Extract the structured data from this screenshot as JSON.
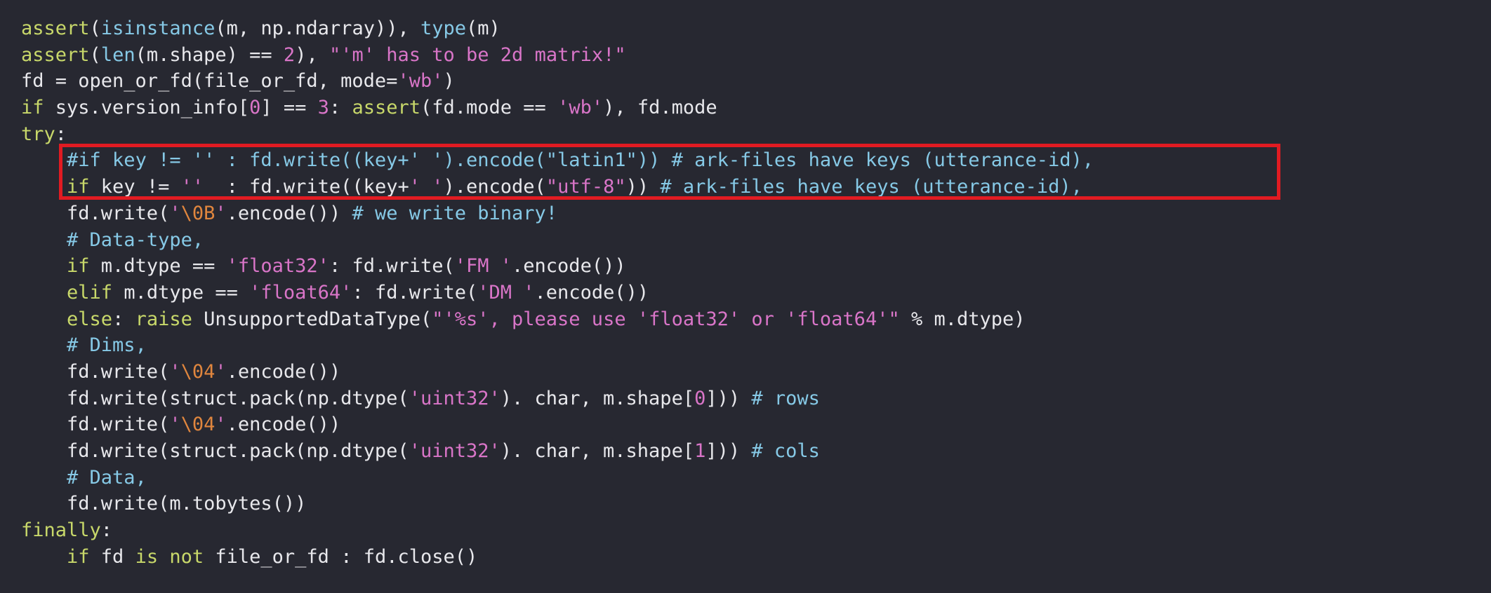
{
  "editor": {
    "colors": {
      "background": "#272831",
      "default": "#e8e8ec",
      "keyword": "#c8d86a",
      "builtin": "#86c9e6",
      "string": "#d975c8",
      "number": "#d975c8",
      "comment": "#86c9e6",
      "escape": "#e0863e",
      "highlight_border": "#e11b22"
    },
    "highlighted_lines": [
      5,
      6
    ],
    "lines": [
      [
        [
          "kw",
          "assert"
        ],
        [
          "def",
          "("
        ],
        [
          "fn",
          "isinstance"
        ],
        [
          "def",
          "(m, np.ndarray)), "
        ],
        [
          "fn",
          "type"
        ],
        [
          "def",
          "(m)"
        ]
      ],
      [
        [
          "kw",
          "assert"
        ],
        [
          "def",
          "("
        ],
        [
          "fn",
          "len"
        ],
        [
          "def",
          "(m.shape) == "
        ],
        [
          "num",
          "2"
        ],
        [
          "def",
          "), "
        ],
        [
          "str",
          "\"'m' has to be 2d matrix!\""
        ]
      ],
      [
        [
          "def",
          "fd = open_or_fd(file_or_fd, mode="
        ],
        [
          "str",
          "'wb'"
        ],
        [
          "def",
          ")"
        ]
      ],
      [
        [
          "kw",
          "if"
        ],
        [
          "def",
          " sys.version_info["
        ],
        [
          "num",
          "0"
        ],
        [
          "def",
          "] == "
        ],
        [
          "num",
          "3"
        ],
        [
          "def",
          ": "
        ],
        [
          "kw",
          "assert"
        ],
        [
          "def",
          "(fd.mode == "
        ],
        [
          "str",
          "'wb'"
        ],
        [
          "def",
          "), fd.mode"
        ]
      ],
      [
        [
          "kw",
          "try"
        ],
        [
          "def",
          ":"
        ]
      ],
      [
        [
          "def",
          "    "
        ],
        [
          "cmt",
          "#if key != '' : fd.write((key+' ').encode(\"latin1\")) # ark-files have keys (utterance-id),"
        ]
      ],
      [
        [
          "def",
          "    "
        ],
        [
          "kw",
          "if"
        ],
        [
          "def",
          " key != "
        ],
        [
          "str",
          "''"
        ],
        [
          "def",
          "  : fd.write((key+"
        ],
        [
          "str",
          "' '"
        ],
        [
          "def",
          ").encode("
        ],
        [
          "str",
          "\"utf-8\""
        ],
        [
          "def",
          ")) "
        ],
        [
          "cmt",
          "# ark-files have keys (utterance-id),"
        ]
      ],
      [
        [
          "def",
          "    fd.write("
        ],
        [
          "str",
          "'"
        ],
        [
          "esc",
          "\\0B"
        ],
        [
          "str",
          "'"
        ],
        [
          "def",
          ".encode()) "
        ],
        [
          "cmt",
          "# we write binary!"
        ]
      ],
      [
        [
          "def",
          "    "
        ],
        [
          "cmt",
          "# Data-type,"
        ]
      ],
      [
        [
          "def",
          "    "
        ],
        [
          "kw",
          "if"
        ],
        [
          "def",
          " m.dtype == "
        ],
        [
          "str",
          "'float32'"
        ],
        [
          "def",
          ": fd.write("
        ],
        [
          "str",
          "'FM '"
        ],
        [
          "def",
          ".encode())"
        ]
      ],
      [
        [
          "def",
          "    "
        ],
        [
          "kw",
          "elif"
        ],
        [
          "def",
          " m.dtype == "
        ],
        [
          "str",
          "'float64'"
        ],
        [
          "def",
          ": fd.write("
        ],
        [
          "str",
          "'DM '"
        ],
        [
          "def",
          ".encode())"
        ]
      ],
      [
        [
          "def",
          "    "
        ],
        [
          "kw",
          "else"
        ],
        [
          "def",
          ": "
        ],
        [
          "kw",
          "raise"
        ],
        [
          "def",
          " UnsupportedDataType("
        ],
        [
          "str",
          "\"'%s', please use 'float32' or 'float64'\""
        ],
        [
          "def",
          " % m.dtype)"
        ]
      ],
      [
        [
          "def",
          "    "
        ],
        [
          "cmt",
          "# Dims,"
        ]
      ],
      [
        [
          "def",
          "    fd.write("
        ],
        [
          "str",
          "'"
        ],
        [
          "esc",
          "\\04"
        ],
        [
          "str",
          "'"
        ],
        [
          "def",
          ".encode())"
        ]
      ],
      [
        [
          "def",
          "    fd.write(struct.pack(np.dtype("
        ],
        [
          "str",
          "'uint32'"
        ],
        [
          "def",
          "). char, m.shape["
        ],
        [
          "num",
          "0"
        ],
        [
          "def",
          "])) "
        ],
        [
          "cmt",
          "# rows"
        ]
      ],
      [
        [
          "def",
          "    fd.write("
        ],
        [
          "str",
          "'"
        ],
        [
          "esc",
          "\\04"
        ],
        [
          "str",
          "'"
        ],
        [
          "def",
          ".encode())"
        ]
      ],
      [
        [
          "def",
          "    fd.write(struct.pack(np.dtype("
        ],
        [
          "str",
          "'uint32'"
        ],
        [
          "def",
          "). char, m.shape["
        ],
        [
          "num",
          "1"
        ],
        [
          "def",
          "])) "
        ],
        [
          "cmt",
          "# cols"
        ]
      ],
      [
        [
          "def",
          "    "
        ],
        [
          "cmt",
          "# Data,"
        ]
      ],
      [
        [
          "def",
          "    fd.write(m.tobytes())"
        ]
      ],
      [
        [
          "kw",
          "finally"
        ],
        [
          "def",
          ":"
        ]
      ],
      [
        [
          "def",
          "    "
        ],
        [
          "kw",
          "if"
        ],
        [
          "def",
          " fd "
        ],
        [
          "kw",
          "is not"
        ],
        [
          "def",
          " file_or_fd : fd.close()"
        ]
      ]
    ]
  }
}
